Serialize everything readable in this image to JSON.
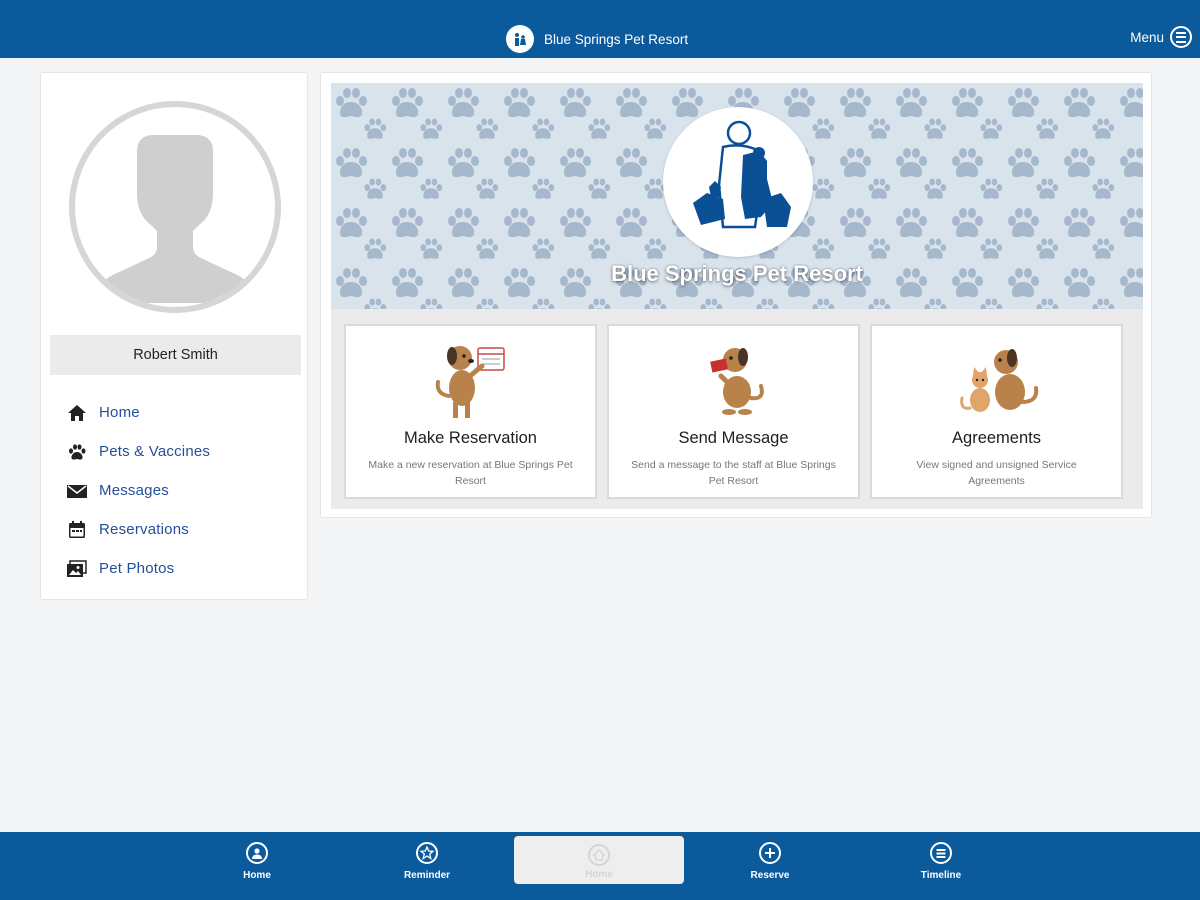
{
  "header": {
    "title": "Blue Springs Pet Resort",
    "menu_label": "Menu"
  },
  "sidebar": {
    "user_name": "Robert Smith",
    "items": [
      {
        "label": "Home",
        "icon": "home-icon"
      },
      {
        "label": "Pets & Vaccines",
        "icon": "paw-icon"
      },
      {
        "label": "Messages",
        "icon": "envelope-icon"
      },
      {
        "label": "Reservations",
        "icon": "calendar-icon"
      },
      {
        "label": "Pet Photos",
        "icon": "photos-icon"
      }
    ]
  },
  "main": {
    "resort_name": "Blue Springs Pet Resort",
    "tiles": [
      {
        "title": "Make Reservation",
        "description": "Make a new reservation at Blue Springs Pet Resort"
      },
      {
        "title": "Send Message",
        "description": "Send a message to the staff at Blue Springs Pet Resort"
      },
      {
        "title": "Agreements",
        "description": "View signed and unsigned Service Agreements"
      }
    ]
  },
  "bottom_nav": {
    "tabs": [
      {
        "label": "Home",
        "icon": "user-circle-icon"
      },
      {
        "label": "Reminder",
        "icon": "star-icon"
      },
      {
        "label": "Home",
        "icon": "home-circle-icon",
        "active": true
      },
      {
        "label": "Reserve",
        "icon": "plus-icon"
      },
      {
        "label": "Timeline",
        "icon": "timeline-icon"
      }
    ]
  },
  "colors": {
    "primary": "#0b5a9c",
    "link": "#24509a",
    "paw_background": "#d9e3ec",
    "paw": "#a6b8cc",
    "dog": "#b8824a"
  }
}
